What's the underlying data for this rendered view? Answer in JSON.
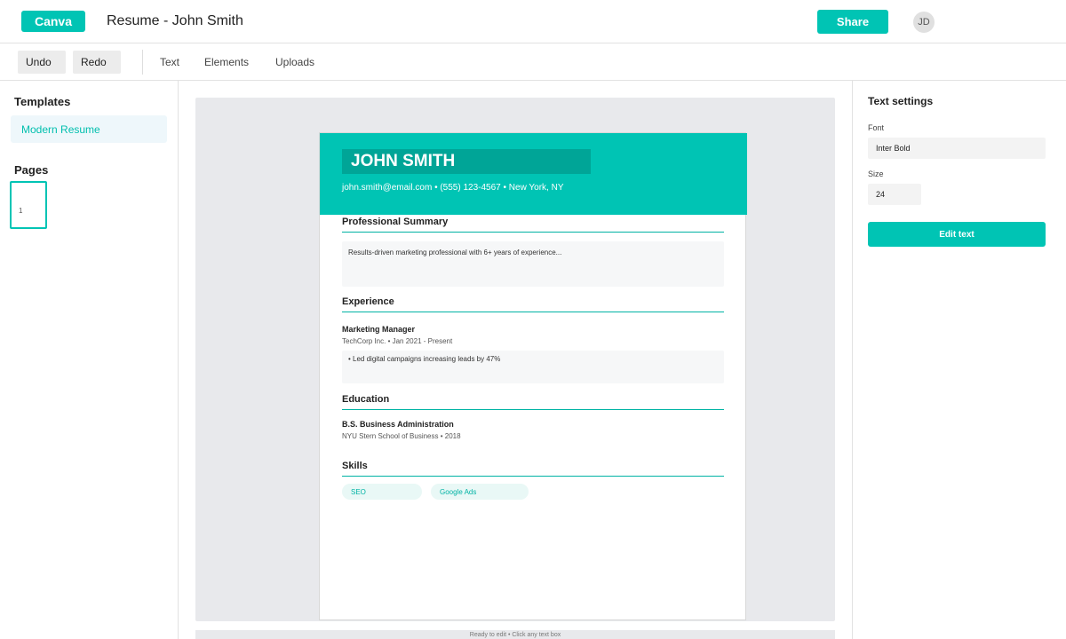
{
  "header": {
    "logo": "Canva",
    "title": "Resume - John Smith",
    "share_label": "Share",
    "avatar_initials": "JD"
  },
  "toolbar": {
    "undo_label": "Undo",
    "redo_label": "Redo",
    "tabs": [
      "Text",
      "Elements",
      "Uploads"
    ]
  },
  "sidebar": {
    "templates_heading": "Templates",
    "template_item": "Modern Resume",
    "pages_heading": "Pages",
    "page_number": "1"
  },
  "resume": {
    "name": "JOHN SMITH",
    "contact": "john.smith@email.com • (555) 123-4567 • New York, NY",
    "summary_title": "Professional Summary",
    "summary_text": "Results-driven marketing professional with 6+ years of experience...",
    "experience_title": "Experience",
    "job_title": "Marketing Manager",
    "job_meta": "TechCorp Inc. • Jan 2021 - Present",
    "job_bullet": "• Led digital campaigns increasing leads by 47%",
    "education_title": "Education",
    "degree": "B.S. Business Administration",
    "school_meta": "NYU Stern School of Business • 2018",
    "skills_title": "Skills",
    "skills": [
      "SEO",
      "Google Ads"
    ]
  },
  "status": "Ready to edit • Click any text box",
  "text_settings": {
    "heading": "Text settings",
    "font_label": "Font",
    "font_value": "Inter Bold",
    "size_label": "Size",
    "size_value": "24",
    "edit_label": "Edit text"
  },
  "colors": {
    "accent": "#00c4b4",
    "accent_dark": "#00a597"
  }
}
